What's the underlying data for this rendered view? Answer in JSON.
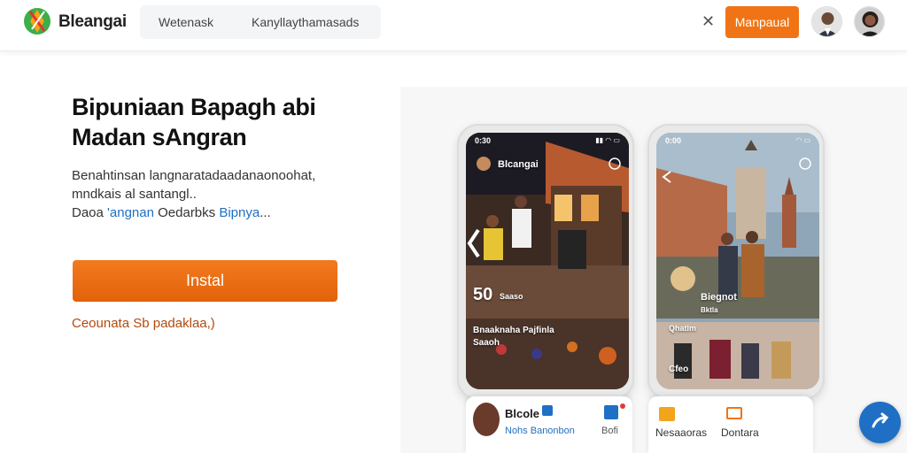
{
  "header": {
    "brand": "Bleangai",
    "nav": [
      "Wetenask",
      "Kanyllaythamasads"
    ],
    "primary_button": "Manpaual",
    "colors": {
      "accent": "#f07416"
    }
  },
  "hero": {
    "title_line1": "Bipuniaan Bapagh abi",
    "title_line2": "Madan sAngran",
    "desc_line1": "Benahtinsan langnaratadaadanaonoohat,",
    "desc_line2": "mndkais al santangl..",
    "desc_line3_a": "Daoa ",
    "desc_line3_link1": "'angnan",
    "desc_line3_b": " Oedarbks ",
    "desc_line3_link2": "Bipnya",
    "desc_line3_c": "...",
    "install_button": "Instal",
    "secondary_link": "Ceounata Sb padaklaa,)"
  },
  "phone_left": {
    "time": "0:30",
    "app_title": "Blcangai",
    "count": "50",
    "count_label": "Saaso",
    "caption_line1": "Bnaaknaha Pajfinla",
    "caption_line2": "Saaoh"
  },
  "phone_right": {
    "time": "0:00",
    "profile_name": "Biegnot",
    "profile_sub": "Bktla",
    "caption": "Cfeo",
    "caption_small": "Qhatlm"
  },
  "cards_left": {
    "name": "Blcole",
    "sub": "Nohs Banonbon",
    "tail": "Bofi"
  },
  "cards_right": {
    "item1": "Nesaaoras",
    "item2": "Dontara"
  },
  "icons": {
    "logo": "brand-logo-icon",
    "close": "close-icon",
    "fab": "chat-icon"
  }
}
